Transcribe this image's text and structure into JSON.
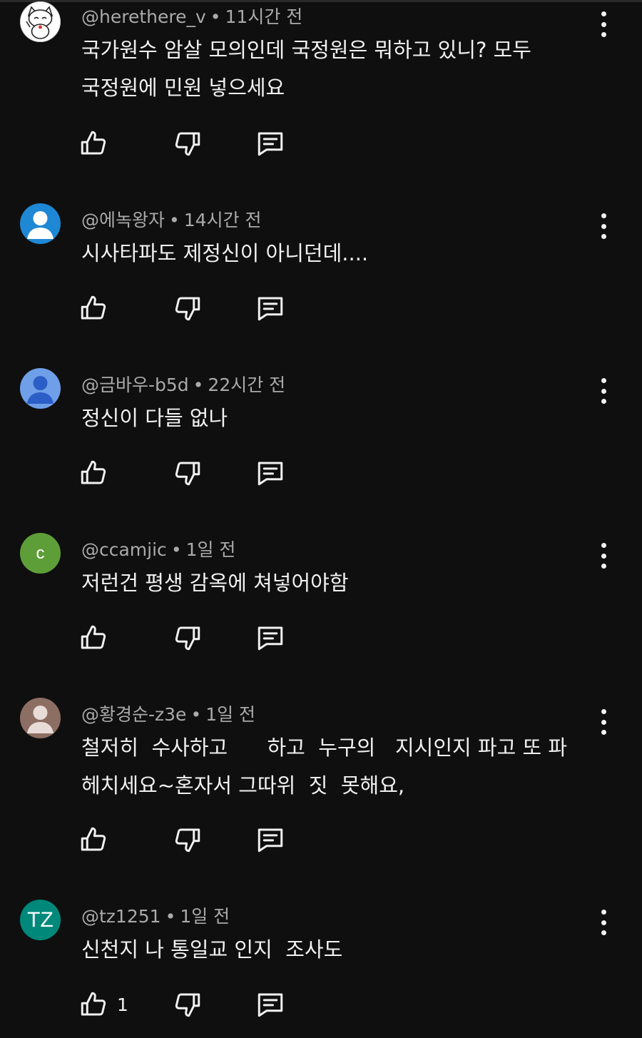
{
  "comments": [
    {
      "handle": "@herethere_v",
      "time": "11시간 전",
      "text": "국가원수 암살 모의인데 국정원은 뭐하고 있니? 모두\n국정원에 민원 넣으세요",
      "likes": "",
      "avatar": {
        "type": "cat-icon"
      }
    },
    {
      "handle": "@에녹왕자",
      "time": "14시간 전",
      "text": "시사타파도 제정신이 아니던데....",
      "likes": "",
      "avatar": {
        "type": "person-icon",
        "color": "#1e88d4"
      }
    },
    {
      "handle": "@금바우-b5d",
      "time": "22시간 전",
      "text": "정신이 다들 없나",
      "likes": "",
      "avatar": {
        "type": "person-icon",
        "color": "#6f9fe8"
      }
    },
    {
      "handle": "@ccamjic",
      "time": "1일 전",
      "text": "저런건 평생 감옥에 쳐넣어야함",
      "likes": "",
      "avatar": {
        "type": "letter",
        "letter": "c",
        "color": "#5e9e38"
      }
    },
    {
      "handle": "@황경순-z3e",
      "time": "1일 전",
      "text": "철저히  수사하고      하고  누구의   지시인지 파고 또 파\n헤치세요~혼자서 그따위  짓  못해요,",
      "likes": "",
      "avatar": {
        "type": "person-icon",
        "color": "#8d6e63"
      }
    },
    {
      "handle": "@tz1251",
      "time": "1일 전",
      "text": "신천지 나 통일교 인지  조사도",
      "likes": "1",
      "avatar": {
        "type": "letter",
        "letter": "TZ",
        "color": "#00897b"
      }
    }
  ],
  "separator": "•"
}
